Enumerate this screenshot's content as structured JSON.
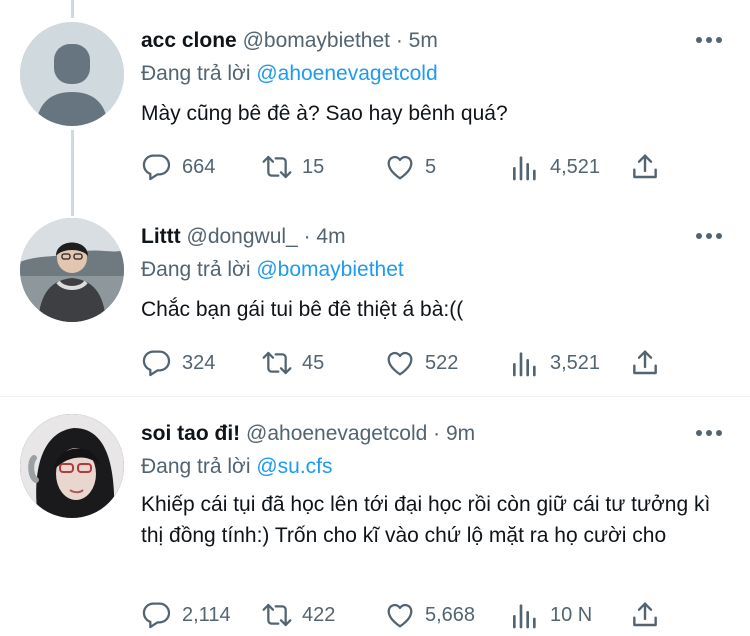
{
  "tweets": [
    {
      "name": "acc clone",
      "handle": "@bomaybiethet",
      "sep": "·",
      "time": "5m",
      "reply_prefix": "Đang trả lời",
      "reply_to": "@ahoenevagetcold",
      "text": "Mày cũng bê đê à? Sao hay bênh quá?",
      "replies": "664",
      "retweets": "15",
      "likes": "5",
      "views": "4,521"
    },
    {
      "name": "Littt",
      "handle": "@dongwul_",
      "sep": "·",
      "time": "4m",
      "reply_prefix": "Đang trả lời",
      "reply_to": "@bomaybiethet",
      "text": "Chắc bạn gái tui bê đê thiệt á bà:((",
      "replies": "324",
      "retweets": "45",
      "likes": "522",
      "views": "3,521"
    },
    {
      "name": "soi tao đi!",
      "handle": "@ahoenevagetcold",
      "sep": "·",
      "time": "9m",
      "reply_prefix": "Đang trả lời",
      "reply_to": "@su.cfs",
      "text": "Khiếp cái tụi đã học lên tới đại học rồi còn giữ cái tư tưởng kì thị đồng tính:) Trốn cho kĩ vào chứ lộ mặt ra họ cười cho",
      "replies": "2,114",
      "retweets": "422",
      "likes": "5,668",
      "views": "10 N"
    }
  ],
  "icons": [
    "more-icon",
    "reply-icon",
    "retweet-icon",
    "like-icon",
    "views-icon",
    "share-icon"
  ],
  "colors": {
    "text": "#0f1419",
    "muted": "#536471",
    "link": "#1d9bf0",
    "thread_line": "#cfd9de",
    "divider": "#eff3f4"
  }
}
